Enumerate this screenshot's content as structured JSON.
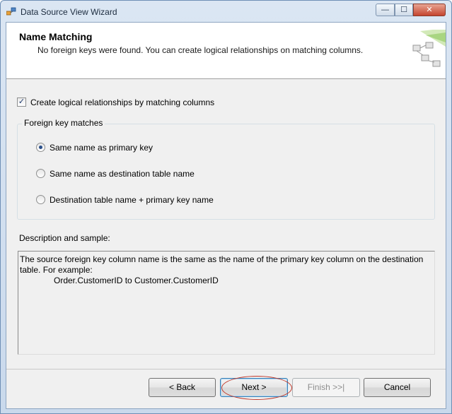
{
  "window": {
    "title": "Data Source View Wizard"
  },
  "controls": {
    "minimize": "—",
    "maximize": "☐",
    "close": "✕"
  },
  "header": {
    "title": "Name Matching",
    "subtitle": "No foreign keys were found. You can create logical relationships on matching columns."
  },
  "checkbox": {
    "label": "Create logical relationships by matching columns",
    "checked": true,
    "mark": "✓"
  },
  "group": {
    "legend": "Foreign key matches",
    "options": [
      {
        "label": "Same name as primary key",
        "selected": true
      },
      {
        "label": "Same name as destination table name",
        "selected": false
      },
      {
        "label": "Destination table name + primary key name",
        "selected": false
      }
    ]
  },
  "description": {
    "label": "Description and sample:",
    "text_line1": "The source foreign key column name is the same as the name of the primary key column on the destination table. For example:",
    "text_line2": "Order.CustomerID to Customer.CustomerID"
  },
  "buttons": {
    "back": "< Back",
    "next": "Next >",
    "finish": "Finish >>|",
    "cancel": "Cancel"
  },
  "colors": {
    "highlight_ring": "#c0392b",
    "title_bar": "#dbe6f3"
  }
}
